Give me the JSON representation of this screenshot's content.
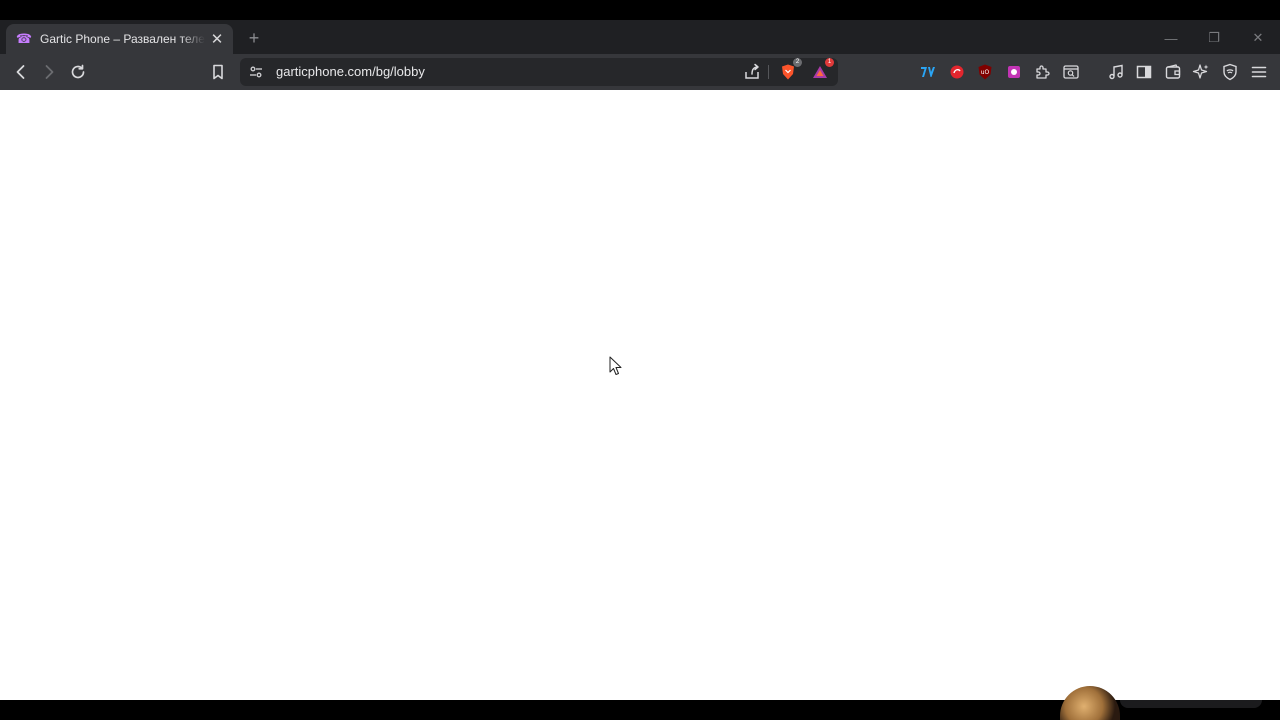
{
  "tab": {
    "title": "Gartic Phone – Развален телефон",
    "favicon": "telephone-icon",
    "close_label": "✕"
  },
  "new_tab_label": "+",
  "window_controls": {
    "minimize": "—",
    "restore": "❐",
    "close": "✕"
  },
  "address_bar": {
    "url": "garticphone.com/bg/lobby"
  },
  "extensions": [
    {
      "name": "seven-tv-icon",
      "color": "#2aa5f5"
    },
    {
      "name": "red-circle-extension-icon",
      "color": "#e3262e"
    },
    {
      "name": "ublock-origin-icon",
      "color": "#800000"
    },
    {
      "name": "purple-extension-icon",
      "color": "#c334b5"
    }
  ],
  "badges": {
    "brave_shields": "2",
    "brave_rewards": "1"
  },
  "colors": {
    "tab_bg": "#36373b",
    "toolbar_bg": "#36373b",
    "page_bg": "#ffffff",
    "favicon": "#c77dff"
  }
}
